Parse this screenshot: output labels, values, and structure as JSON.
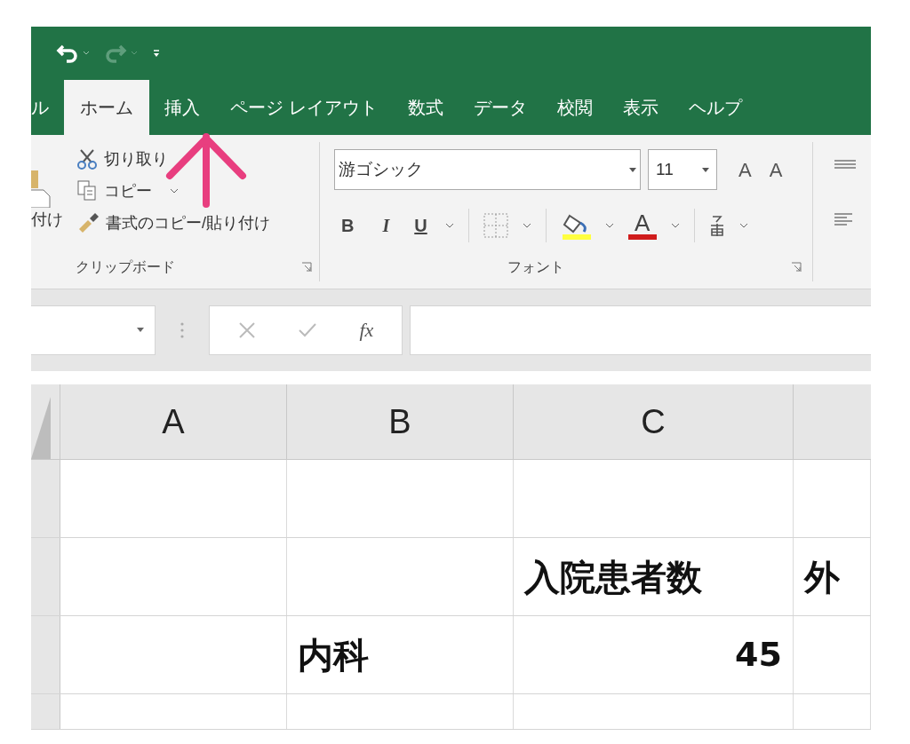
{
  "quick_access": [
    {
      "kind": "undo",
      "disabled": false
    },
    {
      "kind": "redo",
      "disabled": true
    },
    {
      "kind": "customize",
      "disabled": false
    }
  ],
  "tabs": [
    {
      "label": "ル",
      "selected": false
    },
    {
      "label": "ホーム",
      "selected": true
    },
    {
      "label": "挿入",
      "selected": false
    },
    {
      "label": "ページ レイアウト",
      "selected": false
    },
    {
      "label": "数式",
      "selected": false
    },
    {
      "label": "データ",
      "selected": false
    },
    {
      "label": "校閲",
      "selected": false
    },
    {
      "label": "表示",
      "selected": false
    },
    {
      "label": "ヘルプ",
      "selected": false
    }
  ],
  "clipboard": {
    "paste_label": "付け",
    "cut": "切り取り",
    "copy": "コピー",
    "format_painter": "書式のコピー/貼り付け",
    "group_label": "クリップボード"
  },
  "font": {
    "font_name": "游ゴシック",
    "font_size": "11",
    "grow_label": "A",
    "shrink_label": "A",
    "bold_label": "B",
    "italic_label": "I",
    "underline_label": "U",
    "color_label": "A",
    "group_label": "フォント"
  },
  "formula_bar": {
    "function_label": "fx"
  },
  "sheet": {
    "columns": [
      "A",
      "B",
      "C"
    ],
    "rows": [
      {},
      {
        "c": {
          "text": "入院患者数",
          "kind": "text"
        },
        "d": {
          "text": "外",
          "kind": "text"
        }
      },
      {
        "b": {
          "text": "内科",
          "kind": "text"
        },
        "c": {
          "text": "45",
          "kind": "number"
        }
      }
    ]
  }
}
